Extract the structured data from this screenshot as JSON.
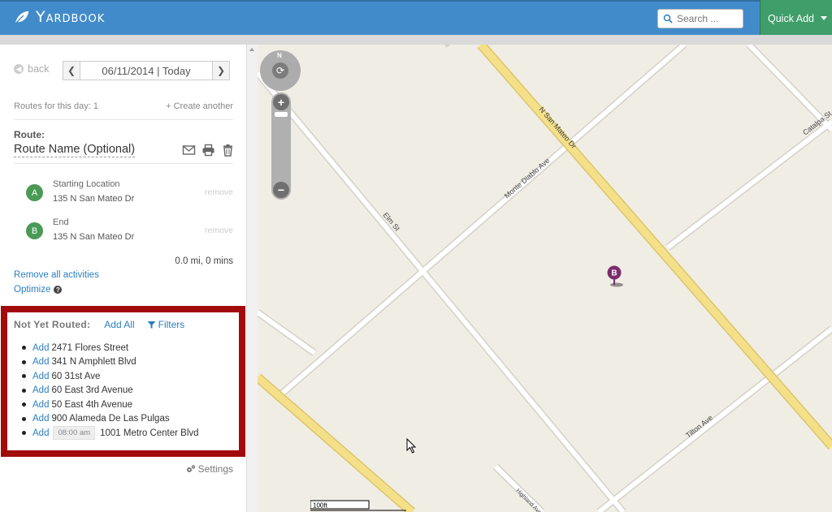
{
  "header": {
    "brand": "Yardbook",
    "search_placeholder": "Search ...",
    "quick_add": "Quick Add"
  },
  "sidebar": {
    "back": "back",
    "date": "06/11/2014 | Today",
    "routes_count": "Routes for this day: 1",
    "create_another": "+ Create another",
    "route_label": "Route:",
    "route_name": "Route Name (Optional)",
    "stops": [
      {
        "pin": "A",
        "label": "Starting Location",
        "address": "135 N San Mateo Dr",
        "remove": "remove"
      },
      {
        "pin": "B",
        "label": "End",
        "address": "135 N San Mateo Dr",
        "remove": "remove"
      }
    ],
    "distance": "0.0 mi, 0 mins",
    "remove_all": "Remove all activities",
    "optimize": "Optimize",
    "unrouted": {
      "title": "Not Yet Routed:",
      "add_all": "Add All",
      "filters": "Filters",
      "add_label": "Add",
      "items": [
        {
          "address": "2471 Flores Street"
        },
        {
          "address": "341 N Amphlett Blvd"
        },
        {
          "address": "60 31st Ave"
        },
        {
          "address": "60 East 3rd Avenue"
        },
        {
          "address": "50 East 4th Avenue"
        },
        {
          "address": "900 Alameda De Las Pulgas"
        },
        {
          "address": "1001 Metro Center Blvd",
          "time": "08:00 am"
        }
      ]
    },
    "settings": "Settings"
  },
  "map": {
    "streets": {
      "n_san_mateo": "N San Mateo Dr",
      "monte_diablo": "Monte Diablo Ave",
      "elm": "Elm St",
      "catalpa": "Catalpa St",
      "tilton": "Tilton Ave",
      "highland": "Highland Ave"
    },
    "marker": "B",
    "nav_north": "N",
    "zoom_in": "+",
    "zoom_out": "−",
    "scale_label": "100ft"
  },
  "colors": {
    "header_blue": "#428bca",
    "quick_add_green": "#3f9e6a",
    "highlight_red": "#a20b0b",
    "link_blue": "#2a7fbf",
    "pin_green": "#4a9a55",
    "marker_purple": "#7b2d6b",
    "major_road": "#f5e08a"
  }
}
